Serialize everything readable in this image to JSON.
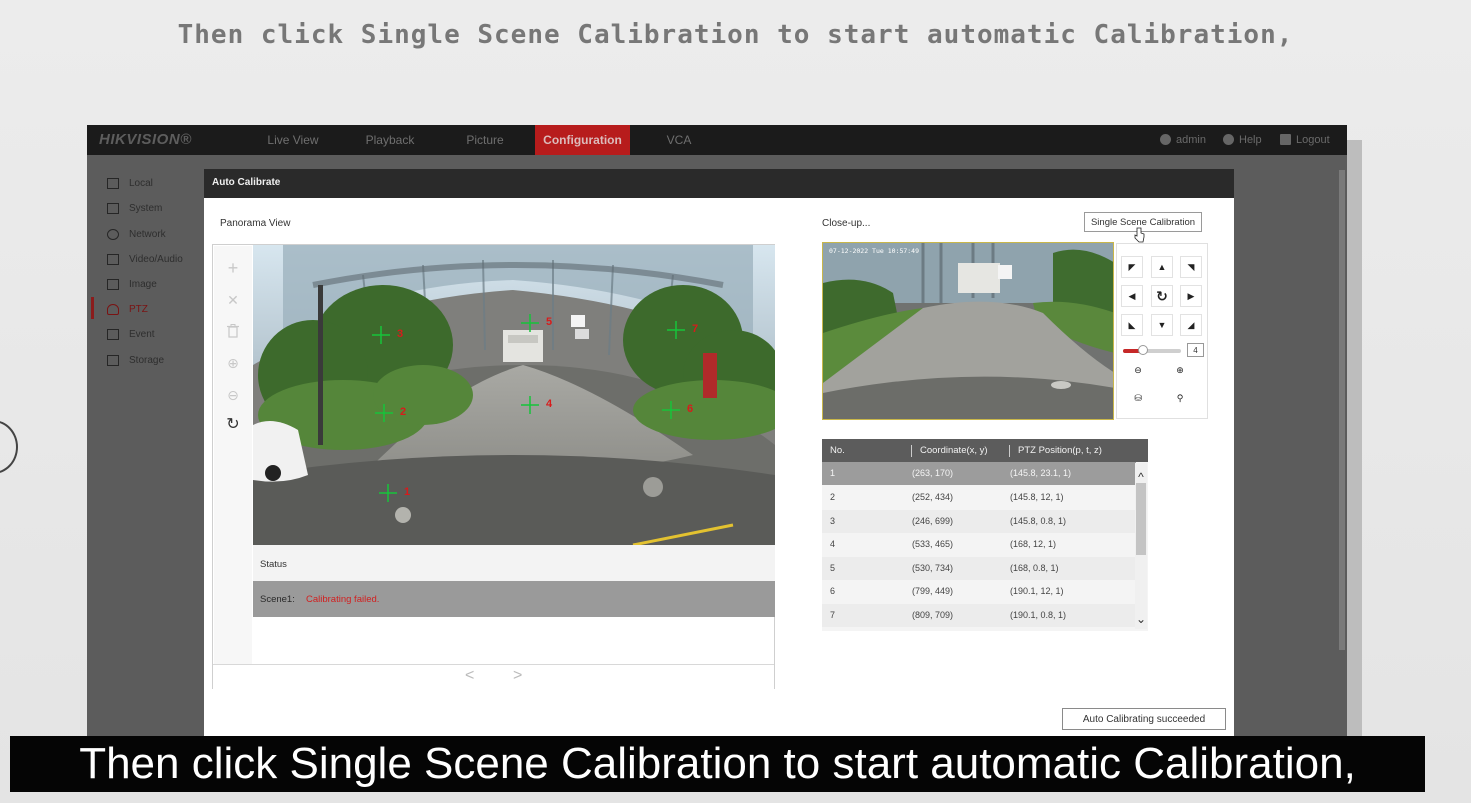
{
  "caption": {
    "top": "Then click Single Scene Calibration to start automatic Calibration,",
    "bottom": "Then click Single Scene Calibration to start automatic Calibration,"
  },
  "nav": {
    "logo_main": "HIKVISION",
    "logo_reg": "®",
    "items": [
      {
        "label": "Live View"
      },
      {
        "label": "Playback"
      },
      {
        "label": "Picture"
      },
      {
        "label": "Configuration",
        "active": true
      },
      {
        "label": "VCA"
      }
    ],
    "right": [
      {
        "icon": "user-icon",
        "label": "admin"
      },
      {
        "icon": "help-icon",
        "label": "Help"
      },
      {
        "icon": "logout-icon",
        "label": "Logout"
      }
    ]
  },
  "sidebar": {
    "items": [
      {
        "icon": "monitor-icon",
        "label": "Local"
      },
      {
        "icon": "system-icon",
        "label": "System"
      },
      {
        "icon": "globe-icon",
        "label": "Network"
      },
      {
        "icon": "video-audio-icon",
        "label": "Video/Audio"
      },
      {
        "icon": "image-icon",
        "label": "Image"
      },
      {
        "icon": "ptz-icon",
        "label": "PTZ",
        "active": true
      },
      {
        "icon": "calendar-icon",
        "label": "Event"
      },
      {
        "icon": "storage-icon",
        "label": "Storage"
      }
    ]
  },
  "dialog": {
    "title": "Auto Calibrate",
    "panorama_label": "Panorama View",
    "closeup_label": "Close-up...",
    "calibrate_button": "Single Scene Calibration",
    "closeup_timestamp": "07-12-2022 Tue 10:57:49",
    "tools": [
      {
        "icon": "plus-icon",
        "glyph": "+"
      },
      {
        "icon": "close-icon",
        "glyph": "✕"
      },
      {
        "icon": "trash-icon",
        "glyph": "🗑"
      },
      {
        "icon": "zoom-in-icon",
        "glyph": "⊕"
      },
      {
        "icon": "zoom-out-icon",
        "glyph": "⊖"
      },
      {
        "icon": "refresh-icon",
        "glyph": "↻"
      }
    ],
    "markers": [
      {
        "label": "1"
      },
      {
        "label": "2"
      },
      {
        "label": "3"
      },
      {
        "label": "4"
      },
      {
        "label": "5"
      },
      {
        "label": "6"
      },
      {
        "label": "7"
      }
    ],
    "status": {
      "header": "Status",
      "scene_label": "Scene1:",
      "scene_message": "Calibrating failed."
    },
    "pager": {
      "prev": "<",
      "next": ">"
    },
    "ptz": {
      "speed_value": "4",
      "speed_level": 0.35,
      "buttons": [
        {
          "icon": "arrow-up-left-icon",
          "glyph": "◤"
        },
        {
          "icon": "arrow-up-icon",
          "glyph": "▲"
        },
        {
          "icon": "arrow-up-right-icon",
          "glyph": "◥"
        },
        {
          "icon": "arrow-left-icon",
          "glyph": "◀"
        },
        {
          "icon": "auto-rotate-icon",
          "glyph": "↻"
        },
        {
          "icon": "arrow-right-icon",
          "glyph": "▶"
        },
        {
          "icon": "arrow-down-left-icon",
          "glyph": "◣"
        },
        {
          "icon": "arrow-down-icon",
          "glyph": "▼"
        },
        {
          "icon": "arrow-down-right-icon",
          "glyph": "◢"
        }
      ],
      "extra_buttons": [
        {
          "icon": "zoom-in-lens-icon",
          "glyph": "⊖"
        },
        {
          "icon": "zoom-out-lens-icon",
          "glyph": "⊕"
        },
        {
          "icon": "preset-icon",
          "glyph": "⛁"
        },
        {
          "icon": "patrol-icon",
          "glyph": "⚲"
        }
      ]
    },
    "table": {
      "headers": [
        "No.",
        "Coordinate(x, y)",
        "PTZ Position(p, t, z)"
      ],
      "rows": [
        {
          "no": "1",
          "coord": "(263, 170)",
          "ptz": "(145.8, 23.1, 1)",
          "selected": true
        },
        {
          "no": "2",
          "coord": "(252, 434)",
          "ptz": "(145.8, 12, 1)"
        },
        {
          "no": "3",
          "coord": "(246, 699)",
          "ptz": "(145.8, 0.8, 1)"
        },
        {
          "no": "4",
          "coord": "(533, 465)",
          "ptz": "(168, 12, 1)"
        },
        {
          "no": "5",
          "coord": "(530, 734)",
          "ptz": "(168, 0.8, 1)"
        },
        {
          "no": "6",
          "coord": "(799, 449)",
          "ptz": "(190.1, 12, 1)"
        },
        {
          "no": "7",
          "coord": "(809, 709)",
          "ptz": "(190.1, 0.8, 1)"
        }
      ]
    },
    "result_button": "Auto Calibrating succeeded"
  },
  "colors": {
    "accent": "#b71c1c",
    "marker": "#16c43a",
    "marker_label": "#d81b1b",
    "error": "#d12020"
  }
}
